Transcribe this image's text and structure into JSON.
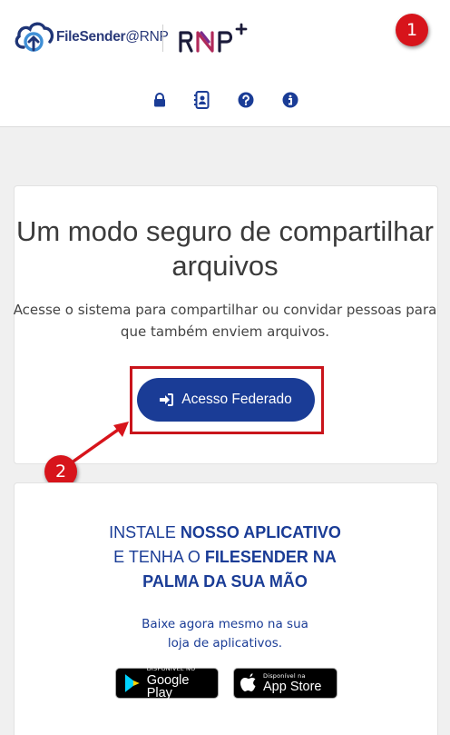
{
  "header": {
    "logo_brand": "FileSender",
    "logo_suffix": "@RNP",
    "partner_logo": "RNP+",
    "nav_icons": [
      "lock-icon",
      "address-book-icon",
      "question-circle-icon",
      "info-circle-icon"
    ]
  },
  "annotations": {
    "badge_1": "1",
    "badge_2": "2"
  },
  "hero": {
    "title": "Um modo seguro de compartilhar arquivos",
    "subtitle": "Acesse o sistema para compartilhar ou convidar pessoas para que também enviem arquivos.",
    "login_button": "Acesso Federado"
  },
  "promo": {
    "line1_regular": "INSTALE ",
    "line1_bold": "NOSSO APLICATIVO",
    "line2_regular": "E TENHA O ",
    "line2_bold": "FILESENDER NA",
    "line3_bold": "PALMA DA SUA MÃO",
    "sub_line1": "Baixe agora mesmo na sua",
    "sub_line2": "loja de aplicativos.",
    "google_small": "DISPONÍVEL NO",
    "google_big": "Google Play",
    "apple_small": "Disponível na",
    "apple_big": "App Store"
  },
  "colors": {
    "primary": "#1a3c96",
    "annotation_red": "#d7141b",
    "text_dark": "#3b3b3b"
  }
}
